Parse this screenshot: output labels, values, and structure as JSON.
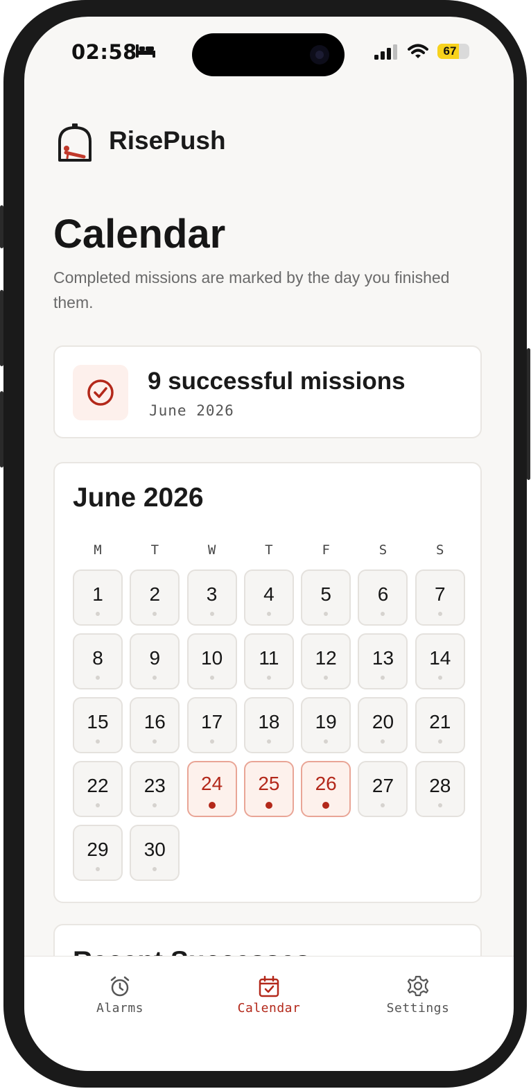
{
  "status_bar": {
    "time": "02:58",
    "sleep_icon": "bed-icon",
    "signal_icon": "cellular-signal-icon",
    "wifi_icon": "wifi-icon",
    "battery_level": "67",
    "battery_fraction": 0.67,
    "battery_color": "#f7d21d"
  },
  "brand": {
    "logo_icon": "risepush-logo-icon",
    "name": "RisePush"
  },
  "page": {
    "title": "Calendar",
    "subtitle": "Completed missions are marked by the day you finished them."
  },
  "summary": {
    "icon": "check-circle-icon",
    "title": "9 successful missions",
    "period": "June 2026"
  },
  "calendar": {
    "month_label": "June 2026",
    "weekdays": [
      "M",
      "T",
      "W",
      "T",
      "F",
      "S",
      "S"
    ],
    "days": [
      {
        "num": "1",
        "done": false
      },
      {
        "num": "2",
        "done": false
      },
      {
        "num": "3",
        "done": false
      },
      {
        "num": "4",
        "done": false
      },
      {
        "num": "5",
        "done": false
      },
      {
        "num": "6",
        "done": false
      },
      {
        "num": "7",
        "done": false
      },
      {
        "num": "8",
        "done": false
      },
      {
        "num": "9",
        "done": false
      },
      {
        "num": "10",
        "done": false
      },
      {
        "num": "11",
        "done": false
      },
      {
        "num": "12",
        "done": false
      },
      {
        "num": "13",
        "done": false
      },
      {
        "num": "14",
        "done": false
      },
      {
        "num": "15",
        "done": false
      },
      {
        "num": "16",
        "done": false
      },
      {
        "num": "17",
        "done": false
      },
      {
        "num": "18",
        "done": false
      },
      {
        "num": "19",
        "done": false
      },
      {
        "num": "20",
        "done": false
      },
      {
        "num": "21",
        "done": false
      },
      {
        "num": "22",
        "done": false
      },
      {
        "num": "23",
        "done": false
      },
      {
        "num": "24",
        "done": true
      },
      {
        "num": "25",
        "done": true
      },
      {
        "num": "26",
        "done": true
      },
      {
        "num": "27",
        "done": false
      },
      {
        "num": "28",
        "done": false
      },
      {
        "num": "29",
        "done": false
      },
      {
        "num": "30",
        "done": false
      }
    ],
    "accent_color": "#b3281a"
  },
  "next_card": {
    "title_partial": "Recent Successes"
  },
  "tabbar": {
    "tabs": [
      {
        "label": "Alarms",
        "icon": "alarm-clock-icon",
        "active": false
      },
      {
        "label": "Calendar",
        "icon": "calendar-check-icon",
        "active": true
      },
      {
        "label": "Settings",
        "icon": "gear-icon",
        "active": false
      }
    ]
  }
}
